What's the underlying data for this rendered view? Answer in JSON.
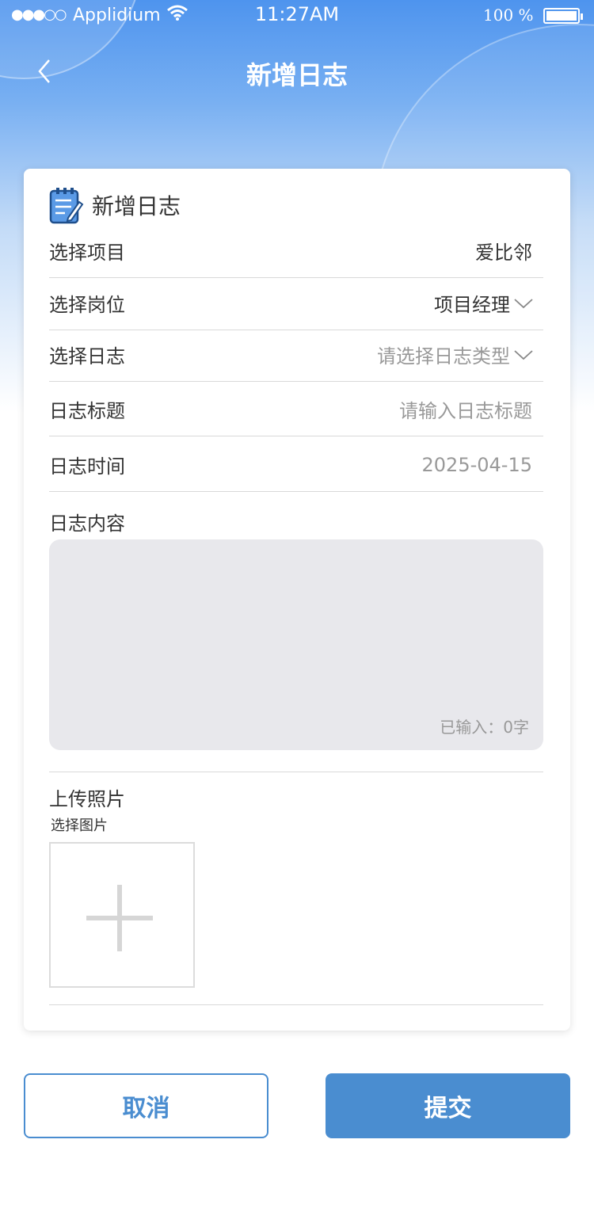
{
  "status_bar": {
    "signal": "●●●○○",
    "carrier": "Applidium",
    "time": "11:27AM",
    "battery": "100 %"
  },
  "nav": {
    "title": "新增日志",
    "back_icon": "chevron-left-icon"
  },
  "card": {
    "title": "新增日志",
    "icon": "notepad-edit-icon",
    "fields": [
      {
        "label": "选择项目",
        "value": "爱比邻"
      },
      {
        "label": "选择岗位",
        "value": "项目经理"
      },
      {
        "label": "选择日志",
        "value": "请选择日志类型"
      },
      {
        "label": "日志标题",
        "placeholder": "请输入日志标题"
      },
      {
        "label": "日志时间",
        "value": "2025-04-15"
      }
    ],
    "content": {
      "label": "日志内容",
      "counter": "已输入：0字"
    },
    "upload": {
      "label": "上传照片",
      "hint": "选择图片"
    }
  },
  "buttons": {
    "cancel": "取消",
    "submit": "提交"
  },
  "colors": {
    "accent": "#4a8dd0",
    "header_gradient_top": "#4e94ee",
    "textarea_bg": "#e8e8ec"
  }
}
